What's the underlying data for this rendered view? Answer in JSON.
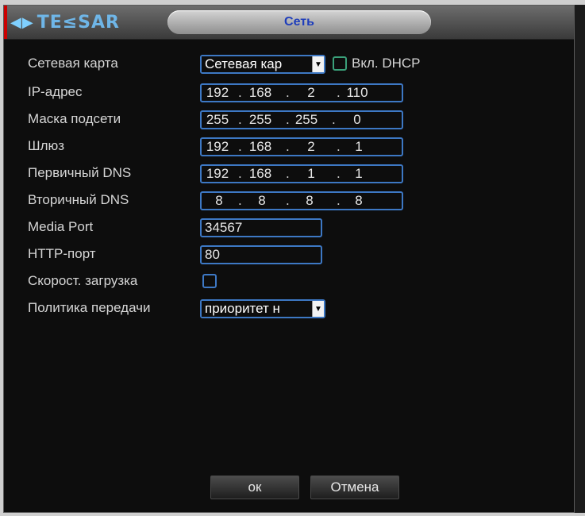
{
  "header": {
    "logo_text": "TE≤SAR",
    "title": "Сеть"
  },
  "form": {
    "network_card": {
      "label": "Сетевая карта",
      "value": "Сетевая кар"
    },
    "dhcp": {
      "label": "Вкл. DHCP",
      "checked": false
    },
    "ip": {
      "label": "IP-адрес",
      "parts": [
        "192",
        "168",
        "2",
        "110"
      ]
    },
    "mask": {
      "label": "Маска подсети",
      "parts": [
        "255",
        "255",
        "255",
        "0"
      ]
    },
    "gateway": {
      "label": "Шлюз",
      "parts": [
        "192",
        "168",
        "2",
        "1"
      ]
    },
    "dns1": {
      "label": "Первичный DNS",
      "parts": [
        "192",
        "168",
        "1",
        "1"
      ]
    },
    "dns2": {
      "label": "Вторичный DNS",
      "parts": [
        "8",
        "8",
        "8",
        "8"
      ]
    },
    "media_port": {
      "label": "Media Port",
      "value": "34567"
    },
    "http_port": {
      "label": "HTTP-порт",
      "value": "80"
    },
    "fast_download": {
      "label": "Скорост. загрузка",
      "checked": false
    },
    "policy": {
      "label": "Политика передачи",
      "value": "приоритет н"
    }
  },
  "buttons": {
    "ok": "ок",
    "cancel": "Отмена"
  },
  "colors": {
    "field_border": "#3d78c4",
    "title_text": "#1e3dbb"
  }
}
